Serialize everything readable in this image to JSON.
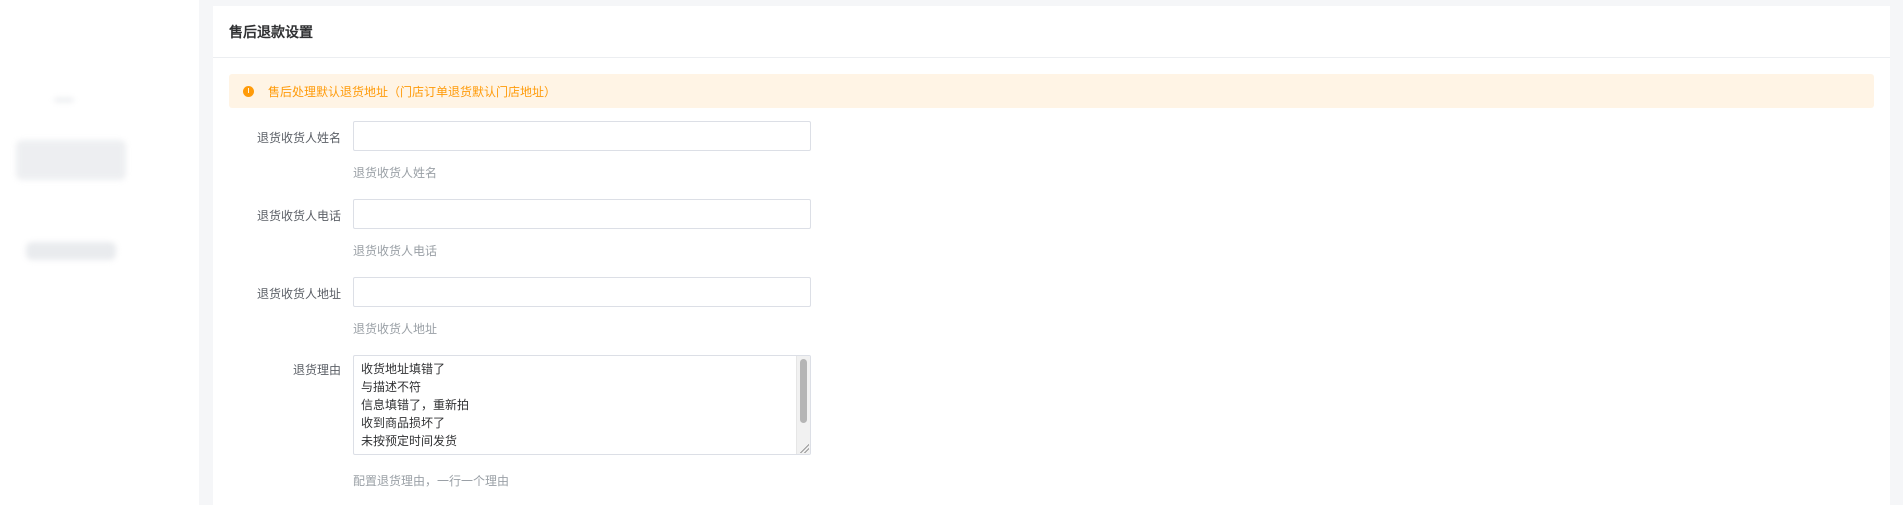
{
  "page": {
    "title": "售后退款设置"
  },
  "alert": {
    "icon": "warning-dot-icon",
    "text": "售后处理默认退货地址（门店订单退货默认门店地址）"
  },
  "form": {
    "name": {
      "label": "退货收货人姓名",
      "value": "",
      "hint": "退货收货人姓名"
    },
    "phone": {
      "label": "退货收货人电话",
      "value": "",
      "hint": "退货收货人电话"
    },
    "address": {
      "label": "退货收货人地址",
      "value": "",
      "hint": "退货收货人地址"
    },
    "reasons": {
      "label": "退货理由",
      "lines": [
        "收货地址填错了",
        "与描述不符",
        "信息填错了，重新拍",
        "收到商品损坏了",
        "未按预定时间发货"
      ],
      "hint": "配置退货理由，一行一个理由"
    }
  },
  "colors": {
    "accent_warning": "#ff9b0a",
    "alert_bg": "#fff4e5"
  }
}
